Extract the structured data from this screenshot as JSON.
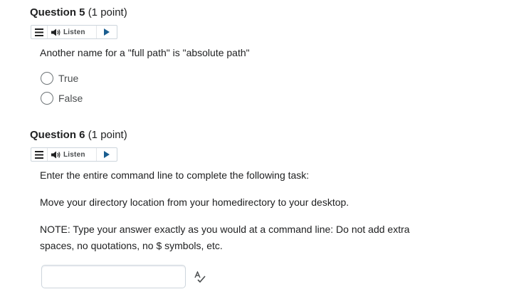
{
  "q5": {
    "title": "Question 5",
    "points": "(1 point)",
    "listen_label": "Listen",
    "prompt": "Another name for a \"full path\" is \"absolute path\"",
    "options": [
      "True",
      "False"
    ]
  },
  "q6": {
    "title": "Question 6",
    "points": "(1 point)",
    "listen_label": "Listen",
    "line1": "Enter the entire command line to complete the following task:",
    "line2": "Move your directory location from your homedirectory to your desktop.",
    "line3": "NOTE: Type your answer exactly as you would at a command line:  Do not add extra",
    "line4": "spaces, no quotations, no $ symbols, etc.",
    "answer_value": ""
  },
  "colors": {
    "text": "#202122",
    "border": "#cdd5dc",
    "muted": "#494c4e"
  },
  "icons": {
    "menu": "menu-icon",
    "speaker": "speaker-icon",
    "play": "play-icon",
    "spellcheck": "spellcheck-icon"
  }
}
